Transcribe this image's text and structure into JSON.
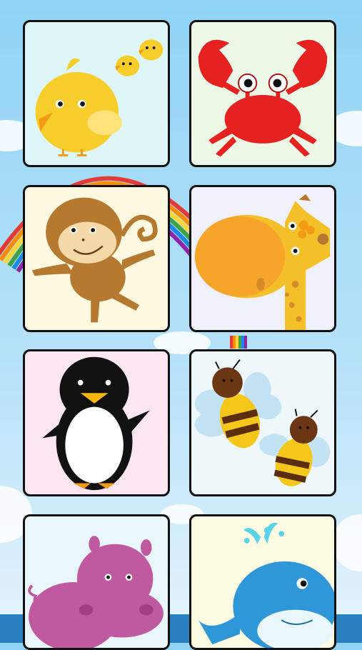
{
  "screen": "animal-picker",
  "colors": {
    "sky": "#a9ddf7",
    "card_border": "#111111",
    "sea": "#2a7fc0"
  },
  "cards": [
    {
      "animal": "chick",
      "bg": "#dff6f8"
    },
    {
      "animal": "crab",
      "bg": "#ecf7e5"
    },
    {
      "animal": "monkey",
      "bg": "#fff9e2"
    },
    {
      "animal": "giraffe",
      "bg": "#f1f1fb"
    },
    {
      "animal": "penguin",
      "bg": "#fbe6f2"
    },
    {
      "animal": "bee",
      "bg": "#eef8fb"
    },
    {
      "animal": "hippo",
      "bg": "#eaf7fa"
    },
    {
      "animal": "whale",
      "bg": "#fdfbe1"
    }
  ]
}
